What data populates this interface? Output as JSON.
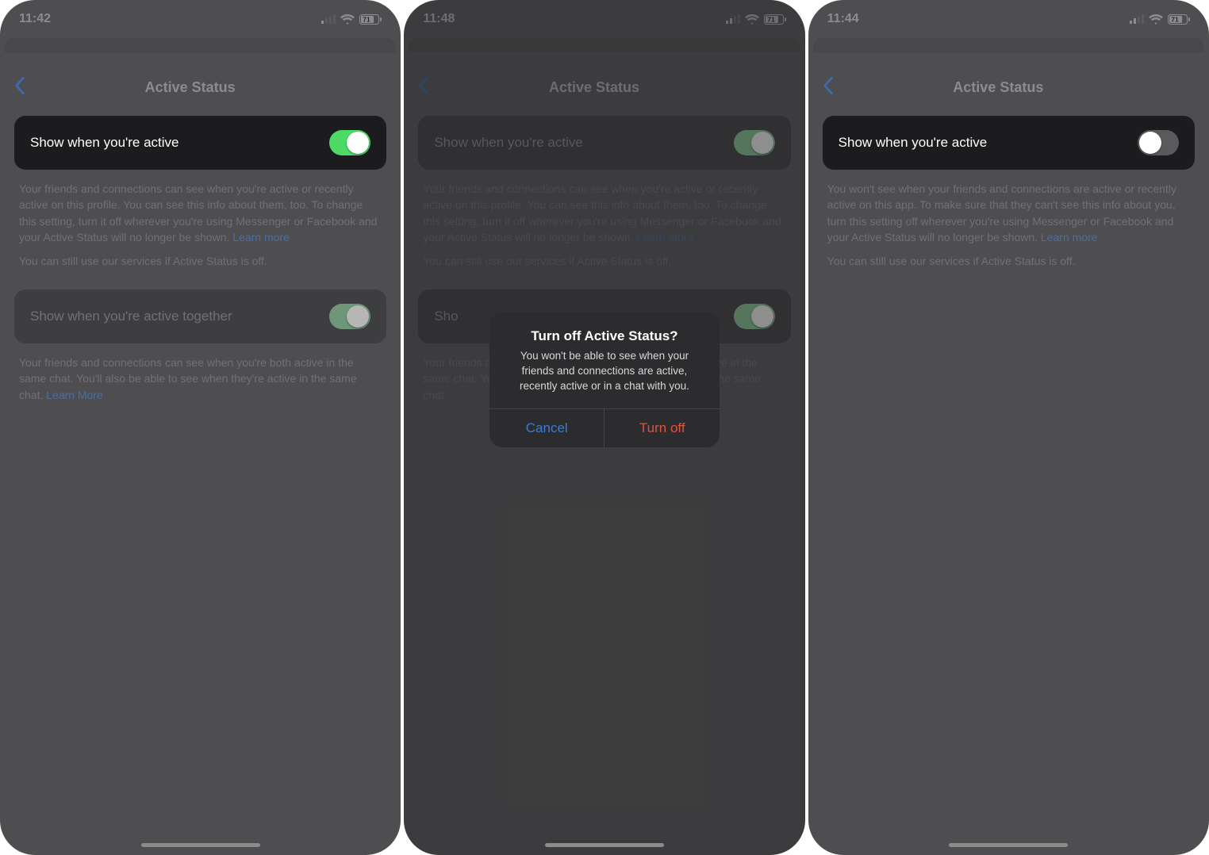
{
  "screens": [
    {
      "time": "11:42",
      "title": "Active Status",
      "battery": "71",
      "row1_label": "Show when you're active",
      "desc": "Your friends and connections can see when you're active or recently active on this profile. You can see this info about them, too. To change this setting, turn it off wherever you're using Messenger or Facebook and your Active Status will no longer be shown. ",
      "learn": "Learn more",
      "desc2": "You can still use our services if Active Status is off.",
      "row2_label": "Show when you're active together",
      "desc3": "Your friends and connections can see when you're both active in the same chat. You'll also be able to see when they're active in the same chat. ",
      "learn3": "Learn More"
    },
    {
      "time": "11:48",
      "title": "Active Status",
      "battery": "71",
      "row1_label": "Show when you're active",
      "desc": "Your friends and connections can see when you're active or recently active on this profile. You can see this info about them, too. To change this setting, turn it off wherever you're using Messenger or Facebook and your Active Status will no longer be shown. ",
      "learn": "Learn more",
      "desc2": "You can still use our services if Active Status is off.",
      "row2_label": "Sho",
      "desc3": "Your friends and connections can see when you're both active in the same chat. You'll also be able to see when they're active in the same chat.",
      "dialog": {
        "title": "Turn off Active Status?",
        "msg": "You won't be able to see when your friends and connections are active, recently active or in a chat with you.",
        "cancel": "Cancel",
        "confirm": "Turn off"
      }
    },
    {
      "time": "11:44",
      "title": "Active Status",
      "battery": "71",
      "row1_label": "Show when you're active",
      "desc": "You won't see when your friends and connections are active or recently active on this app. To make sure that they can't see this info about you, turn this setting off wherever you're using Messenger or Facebook and your Active Status will no longer be shown. ",
      "learn": "Learn more",
      "desc2": "You can still use our services if Active Status is off."
    }
  ]
}
